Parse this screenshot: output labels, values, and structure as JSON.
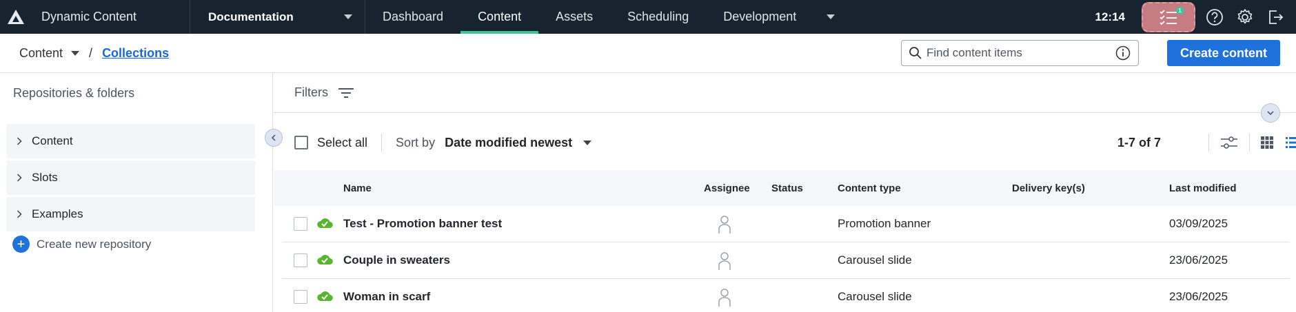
{
  "topbar": {
    "app_name": "Dynamic Content",
    "hub_name": "Documentation",
    "tabs": [
      "Dashboard",
      "Content",
      "Assets",
      "Scheduling",
      "Development"
    ],
    "active_tab": "Content",
    "time": "12:14",
    "tasks_badge": "1",
    "icons": [
      "dynamic-content-logo-icon",
      "hub-dropdown-caret-icon",
      "development-dropdown-caret-icon",
      "task-list-icon",
      "help-icon",
      "settings-gear-icon",
      "logout-icon"
    ]
  },
  "breadcrumb": {
    "root": "Content",
    "separator": "/",
    "current": "Collections"
  },
  "search": {
    "placeholder": "Find content items",
    "value": ""
  },
  "create_button": "Create content",
  "sidebar": {
    "title": "Repositories & folders",
    "items": [
      {
        "label": "Content"
      },
      {
        "label": "Slots"
      },
      {
        "label": "Examples"
      }
    ],
    "create_label": "Create new repository"
  },
  "filters": {
    "label": "Filters"
  },
  "toolbar": {
    "select_all": "Select all",
    "sort_label": "Sort by",
    "sort_value": "Date modified newest",
    "count": "1-7 of 7"
  },
  "table": {
    "columns": [
      "Name",
      "Assignee",
      "Status",
      "Content type",
      "Delivery key(s)",
      "Last modified"
    ],
    "rows": [
      {
        "name": "Test - Promotion banner test",
        "assignee": "",
        "status": "",
        "content_type": "Promotion banner",
        "delivery_keys": "",
        "last_modified": "03/09/2025"
      },
      {
        "name": "Couple in sweaters",
        "assignee": "",
        "status": "",
        "content_type": "Carousel slide",
        "delivery_keys": "",
        "last_modified": "23/06/2025"
      },
      {
        "name": "Woman in scarf",
        "assignee": "",
        "status": "",
        "content_type": "Carousel slide",
        "delivery_keys": "",
        "last_modified": "23/06/2025"
      }
    ]
  },
  "colors": {
    "topbar_bg": "#17242f",
    "active_tab_accent": "#3fc39a",
    "primary_blue": "#1f72db",
    "published_green": "#58b52f",
    "task_highlight": "#c57d83"
  }
}
